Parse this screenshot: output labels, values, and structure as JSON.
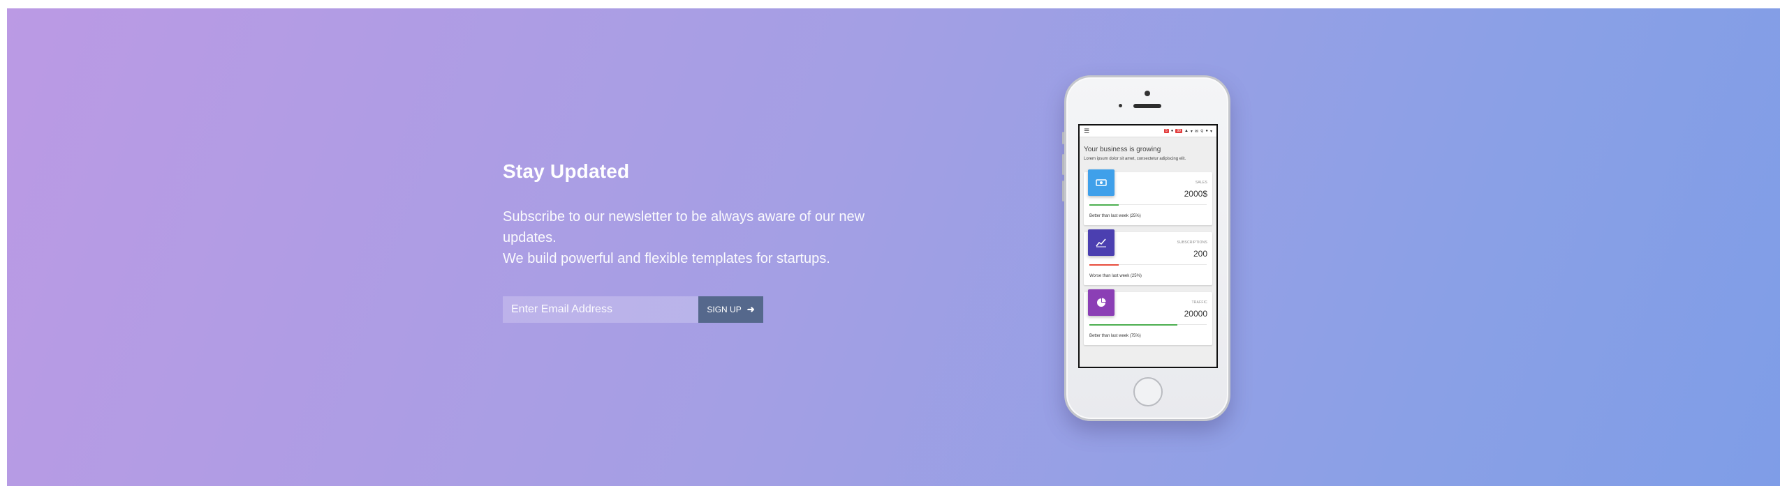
{
  "newsletter": {
    "title": "Stay Updated",
    "line1": "Subscribe to our newsletter to be always aware of our new updates.",
    "line2": "We build powerful and flexible templates for startups.",
    "email_placeholder": "Enter Email Address",
    "signup_label": "SIGN UP",
    "signup_icon": "arrow-right-icon"
  },
  "phone_screen": {
    "navbar": {
      "menu_icon": "hamburger-icon",
      "badge_1": "5",
      "badge_2": "99"
    },
    "intro_title": "Your business is growing",
    "intro_subtitle": "Lorem ipsum dolor sit amet, consectetur adipiscing elit.",
    "cards": [
      {
        "label": "SALES",
        "value": "2000$",
        "footer": "Better than last week (25%)",
        "icon": "money-icon",
        "color": "#3fa0ea",
        "bar_color": "#4caf50",
        "progress": 25
      },
      {
        "label": "SUBSCRIPTIONS",
        "value": "200",
        "footer": "Worse than last week (25%)",
        "icon": "chart-line-icon",
        "color": "#4b3fb0",
        "bar_color": "#e74c3c",
        "progress": 25
      },
      {
        "label": "TRAFFIC",
        "value": "20000",
        "footer": "Better than last week (75%)",
        "icon": "pie-chart-icon",
        "color": "#8b3fb5",
        "bar_color": "#4caf50",
        "progress": 75
      }
    ]
  }
}
